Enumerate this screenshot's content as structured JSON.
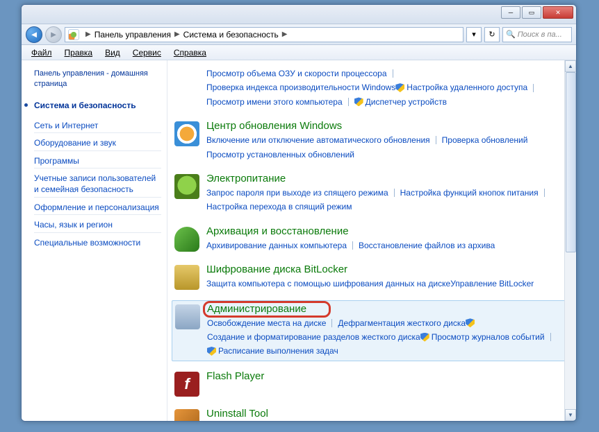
{
  "titlebar": {
    "min": "─",
    "max": "▭",
    "close": "✕"
  },
  "breadcrumb": {
    "root": "Панель управления",
    "current": "Система и безопасность"
  },
  "search": {
    "placeholder": "Поиск в па..."
  },
  "menu": {
    "file": "Файл",
    "edit": "Правка",
    "view": "Вид",
    "tools": "Сервис",
    "help": "Справка"
  },
  "sidebar": {
    "home": "Панель управления - домашняя страница",
    "current": "Система и безопасность",
    "items": [
      "Сеть и Интернет",
      "Оборудование и звук",
      "Программы",
      "Учетные записи пользователей и семейная безопасность",
      "Оформление и персонализация",
      "Часы, язык и регион",
      "Специальные возможности"
    ]
  },
  "sections": {
    "sys": {
      "links": [
        {
          "t": "Просмотр объема ОЗУ и скорости процессора",
          "s": false
        },
        {
          "t": "Проверка индекса производительности Windows",
          "s": false
        },
        {
          "t": "Настройка удаленного доступа",
          "s": true
        },
        {
          "t": "Просмотр имени этого компьютера",
          "s": false
        },
        {
          "t": "Диспетчер устройств",
          "s": true
        }
      ]
    },
    "upd": {
      "title": "Центр обновления Windows",
      "links": [
        {
          "t": "Включение или отключение автоматического обновления",
          "s": false
        },
        {
          "t": "Проверка обновлений",
          "s": false
        },
        {
          "t": "Просмотр установленных обновлений",
          "s": false
        }
      ]
    },
    "pwr": {
      "title": "Электропитание",
      "links": [
        {
          "t": "Запрос пароля при выходе из спящего режима",
          "s": false
        },
        {
          "t": "Настройка функций кнопок питания",
          "s": false
        },
        {
          "t": "Настройка перехода в спящий режим",
          "s": false
        }
      ]
    },
    "bak": {
      "title": "Архивация и восстановление",
      "links": [
        {
          "t": "Архивирование данных компьютера",
          "s": false
        },
        {
          "t": "Восстановление файлов из архива",
          "s": false
        }
      ]
    },
    "bit": {
      "title": "Шифрование диска BitLocker",
      "links": [
        {
          "t": "Защита компьютера с помощью шифрования данных на диске",
          "s": false
        },
        {
          "t": "Управление BitLocker",
          "s": false
        }
      ]
    },
    "adm": {
      "title": "Администрирование",
      "links": [
        {
          "t": "Освобождение места на диске",
          "s": false
        },
        {
          "t": "Дефрагментация жесткого диска",
          "s": false
        },
        {
          "t": "Создание и форматирование разделов жесткого диска",
          "s": true
        },
        {
          "t": "Просмотр журналов событий",
          "s": true
        },
        {
          "t": "Расписание выполнения задач",
          "s": true
        }
      ]
    },
    "fla": {
      "title": "Flash Player"
    },
    "uni": {
      "title": "Uninstall Tool"
    }
  }
}
